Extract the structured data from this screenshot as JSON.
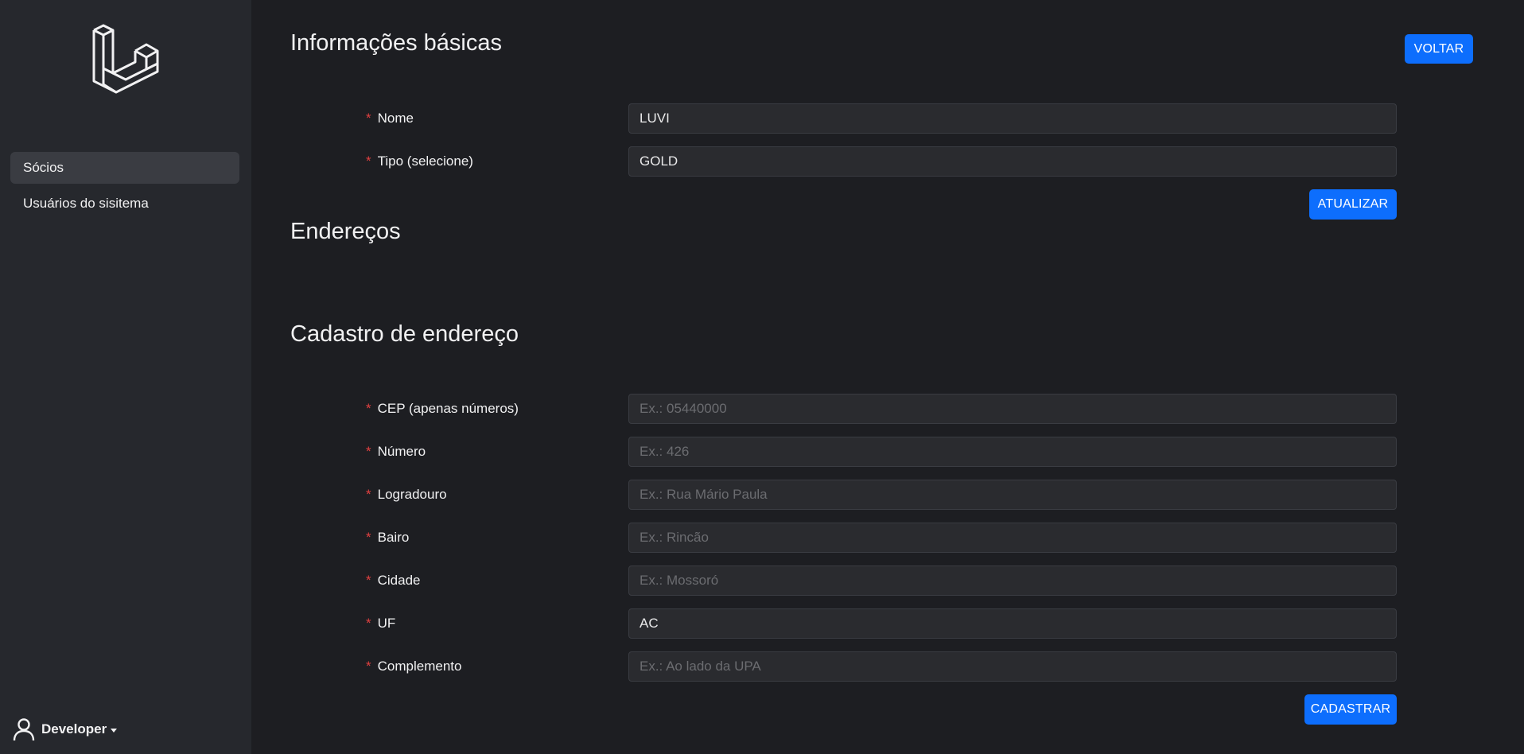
{
  "sidebar": {
    "items": [
      {
        "label": "Sócios",
        "active": true
      },
      {
        "label": "Usuários do sisitema",
        "active": false
      }
    ],
    "user": {
      "name": "Developer",
      "icon": "user-icon"
    },
    "logo_icon": "laravel-logo-icon"
  },
  "basic_info": {
    "title": "Informações básicas",
    "back_button": "VOLTAR",
    "fields": {
      "nome": {
        "label": "Nome",
        "value": "LUVI",
        "placeholder": ""
      },
      "tipo": {
        "label": "Tipo (selecione)",
        "value": "GOLD",
        "placeholder": ""
      }
    },
    "update_button": "ATUALIZAR"
  },
  "addresses": {
    "title": "Endereços"
  },
  "address_form": {
    "title": "Cadastro de endereço",
    "fields": {
      "cep": {
        "label": "CEP (apenas números)",
        "value": "",
        "placeholder": "Ex.: 05440000"
      },
      "numero": {
        "label": "Número",
        "value": "",
        "placeholder": "Ex.: 426"
      },
      "logradouro": {
        "label": "Logradouro",
        "value": "",
        "placeholder": "Ex.: Rua Mário Paula"
      },
      "bairro": {
        "label": "Bairo",
        "value": "",
        "placeholder": "Ex.: Rincão"
      },
      "cidade": {
        "label": "Cidade",
        "value": "",
        "placeholder": "Ex.: Mossoró"
      },
      "uf": {
        "label": "UF",
        "value": "AC",
        "placeholder": ""
      },
      "complemento": {
        "label": "Complemento",
        "value": "",
        "placeholder": "Ex.: Ao lado da UPA"
      }
    },
    "submit_button": "CADASTRAR"
  },
  "required_marker": "*",
  "colors": {
    "background": "#1d1e22",
    "sidebar": "#26282d",
    "accent": "#0d6efd",
    "required": "#e04040"
  }
}
